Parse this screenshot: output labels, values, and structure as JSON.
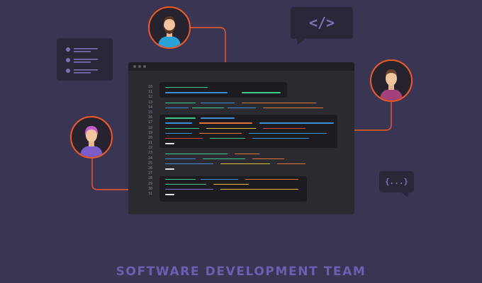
{
  "title": "SOFTWARE DEVELOPMENT TEAM",
  "code_bubble": {
    "label": "</>"
  },
  "braces_bubble": {
    "label": "{...}"
  },
  "line_numbers": [
    "10",
    "11",
    "12",
    "13",
    "14",
    "15",
    "16",
    "17",
    "18",
    "19",
    "20",
    "21",
    "22",
    "23",
    "24",
    "25",
    "26",
    "27",
    "28",
    "29",
    "30",
    "31"
  ],
  "colors": {
    "background": "#3a3553",
    "editor": "#2b2a30",
    "accent": "#f05a28",
    "title": "#6a5fb0",
    "code_green": "#3ec98a",
    "code_blue": "#3f8fd8",
    "code_orange": "#e0743a",
    "code_yellow": "#e0c03a",
    "code_red": "#d9473b",
    "code_white": "#e8e8e8",
    "code_purple": "#8d64d8"
  },
  "avatars": [
    {
      "name": "developer-top",
      "hair": "beard",
      "shirt": "#2aa3d8"
    },
    {
      "name": "developer-right",
      "shirt": "#a4407a"
    },
    {
      "name": "developer-left",
      "hair": "#c25fc8",
      "shirt": "#7b5cc8"
    }
  ]
}
